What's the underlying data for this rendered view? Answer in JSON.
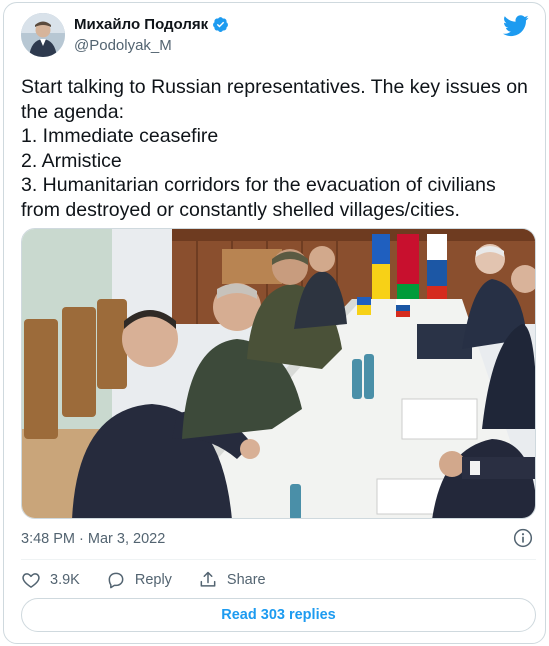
{
  "author": {
    "display_name": "Михайло Подоляк",
    "handle": "@Podolyak_M",
    "verified": true
  },
  "tweet": {
    "lines": [
      "Start talking to Russian representatives. The key issues on",
      "the agenda:",
      "1. Immediate ceasefire",
      "2. Armistice",
      "3. Humanitarian corridors for the evacuation of civilians",
      "from destroyed or constantly shelled villages/cities."
    ],
    "timestamp": "3:48 PM · Mar 3, 2022"
  },
  "actions": {
    "like_count": "3.9K",
    "reply_label": "Reply",
    "share_label": "Share"
  },
  "read_replies_label": "Read 303 replies",
  "icons": {
    "brand": "twitter-bird-icon",
    "verified": "verified-badge-icon",
    "info": "info-icon",
    "like": "heart-icon",
    "reply": "reply-bubble-icon",
    "share": "share-icon"
  },
  "colors": {
    "brand_blue": "#1d9bf0",
    "text_primary": "#0f1419",
    "text_secondary": "#536471",
    "border": "#cfd9de"
  }
}
